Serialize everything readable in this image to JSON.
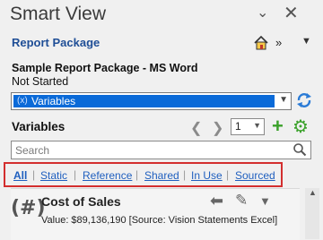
{
  "window": {
    "title": "Smart View",
    "chevron_icon": "chevron-down",
    "close_icon": "close"
  },
  "panel": {
    "link_title": "Report Package",
    "nav_arrows": "» ",
    "menu_glyph": "▼"
  },
  "document": {
    "name": "Sample Report Package - MS Word",
    "status": "Not Started"
  },
  "view_select": {
    "prefix": "(x)",
    "value": "Variables"
  },
  "variables_section": {
    "label": "Variables",
    "page": "1"
  },
  "search": {
    "placeholder": "Search"
  },
  "filters": [
    {
      "label": "All",
      "active": true
    },
    {
      "label": "Static",
      "active": false
    },
    {
      "label": "Reference",
      "active": false
    },
    {
      "label": "Shared",
      "active": false
    },
    {
      "label": "In Use",
      "active": false
    },
    {
      "label": "Sourced",
      "active": false
    }
  ],
  "variable_card": {
    "icon": "(#)",
    "name": "Cost of Sales",
    "value_text": "Value:  $89,136,190  [Source: Vision Statements Excel]"
  },
  "colors": {
    "accent_blue": "#1f4e96",
    "selection_blue": "#0a6ad8",
    "highlight_red": "#d32f2f",
    "add_green": "#3aa12a"
  }
}
